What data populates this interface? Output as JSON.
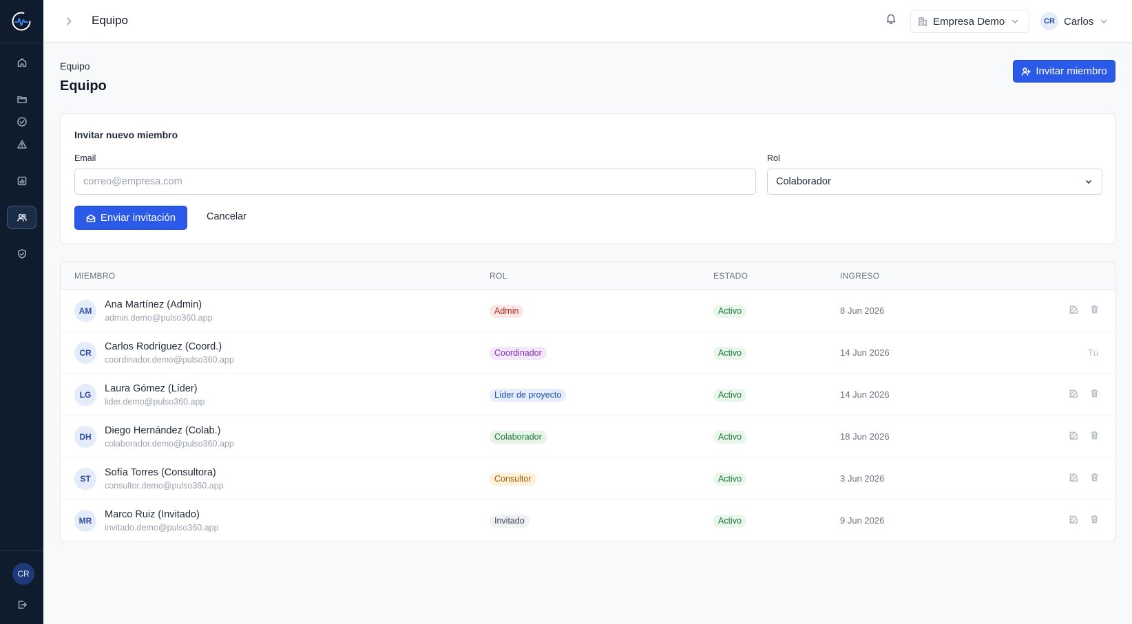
{
  "topbar": {
    "title": "Equipo",
    "company": "Empresa Demo",
    "user_initials": "CR",
    "user_name": "Carlos"
  },
  "sidebar": {
    "items": [
      {
        "icon": "home-icon"
      },
      {
        "icon": "folder-icon"
      },
      {
        "icon": "check-circle-icon"
      },
      {
        "icon": "alert-triangle-icon"
      },
      {
        "icon": "chart-icon"
      },
      {
        "icon": "users-icon",
        "active": true
      },
      {
        "icon": "shield-icon"
      }
    ],
    "avatar_initials": "CR"
  },
  "header": {
    "breadcrumb": "Equipo",
    "title": "Equipo",
    "invite_button": "Invitar miembro"
  },
  "invite_form": {
    "title": "Invitar nuevo miembro",
    "email_label": "Email",
    "email_placeholder": "correo@empresa.com",
    "role_label": "Rol",
    "role_value": "Colaborador",
    "send_button": "Enviar invitación",
    "cancel_button": "Cancelar"
  },
  "table": {
    "columns": [
      "MIEMBRO",
      "ROL",
      "ESTADO",
      "INGRESO"
    ],
    "rows": [
      {
        "initials": "AM",
        "name": "Ana Martínez (Admin)",
        "email": "admin.demo@pulso360.app",
        "role": "Admin",
        "role_bg": "#fbe7e7",
        "role_fg": "#b42318",
        "status": "Activo",
        "date": "8 Jun 2026",
        "self": false
      },
      {
        "initials": "CR",
        "name": "Carlos Rodríguez (Coord.)",
        "email": "coordinador.demo@pulso360.app",
        "role": "Coordinador",
        "role_bg": "#f3e8fb",
        "role_fg": "#7e2fb0",
        "status": "Activo",
        "date": "14 Jun 2026",
        "self": true,
        "self_label": "Tú"
      },
      {
        "initials": "LG",
        "name": "Laura Gómez (Líder)",
        "email": "lider.demo@pulso360.app",
        "role": "Líder de proyecto",
        "role_bg": "#e6edfb",
        "role_fg": "#1f4fb5",
        "status": "Activo",
        "date": "14 Jun 2026",
        "self": false
      },
      {
        "initials": "DH",
        "name": "Diego Hernández (Colab.)",
        "email": "colaborador.demo@pulso360.app",
        "role": "Colaborador",
        "role_bg": "#e6f4ea",
        "role_fg": "#1e7a3c",
        "status": "Activo",
        "date": "18 Jun 2026",
        "self": false
      },
      {
        "initials": "ST",
        "name": "Sofía Torres (Consultora)",
        "email": "consultor.demo@pulso360.app",
        "role": "Consultor",
        "role_bg": "#fdf1d9",
        "role_fg": "#a15c07",
        "status": "Activo",
        "date": "3 Jun 2026",
        "self": false
      },
      {
        "initials": "MR",
        "name": "Marco Ruiz (Invitado)",
        "email": "invitado.demo@pulso360.app",
        "role": "Invitado",
        "role_bg": "#f1f2f4",
        "role_fg": "#374151",
        "status": "Activo",
        "date": "9 Jun 2026",
        "self": false
      }
    ]
  }
}
